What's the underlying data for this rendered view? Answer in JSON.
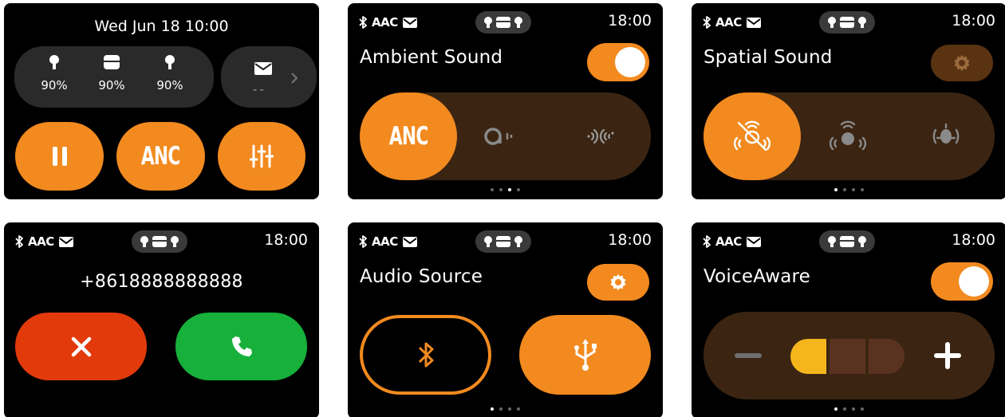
{
  "colors": {
    "accent": "#f28a1f",
    "track": "#3b2512",
    "decline": "#e23a0b",
    "accept": "#16b03a",
    "level_on": "#f5b61d",
    "level_off": "#5a3320"
  },
  "status": {
    "codec": "AAC",
    "time": "18:00",
    "icons": [
      "bluetooth-icon",
      "mail-icon",
      "earbuds-case-icon"
    ]
  },
  "home": {
    "datetime": "Wed Jun 18  10:00",
    "battery": [
      {
        "device": "left-earbud-icon",
        "percent": "90%"
      },
      {
        "device": "case-icon",
        "percent": "90%"
      },
      {
        "device": "right-earbud-icon",
        "percent": "90%"
      }
    ],
    "message_preview": "--",
    "buttons": {
      "pause": "pause-icon",
      "anc": "ANC",
      "eq": "equalizer-icon"
    }
  },
  "ambient": {
    "title": "Ambient Sound",
    "toggle_on": true,
    "options": [
      {
        "id": "anc",
        "label": "ANC",
        "active": true
      },
      {
        "id": "ambient-aware",
        "icon": "ambient-aware-icon",
        "active": false
      },
      {
        "id": "talk-thru",
        "icon": "talk-thru-icon",
        "active": false
      }
    ],
    "page_index": 2,
    "page_count": 4
  },
  "spatial": {
    "title": "Spatial Sound",
    "options": [
      {
        "id": "off",
        "icon": "spatial-off-icon",
        "active": true
      },
      {
        "id": "fixed",
        "icon": "spatial-fixed-icon",
        "active": false
      },
      {
        "id": "head-tracking",
        "icon": "head-tracking-icon",
        "active": false
      }
    ],
    "page_index": 0,
    "page_count": 4
  },
  "call": {
    "number": "+8618888888888",
    "decline": "decline-icon",
    "accept": "accept-call-icon"
  },
  "audio_source": {
    "title": "Audio Source",
    "options": [
      {
        "id": "bluetooth",
        "icon": "bluetooth-icon",
        "active": false
      },
      {
        "id": "usb",
        "icon": "usb-icon",
        "active": true
      }
    ],
    "page_index": 0,
    "page_count": 4
  },
  "voiceaware": {
    "title": "VoiceAware",
    "toggle_on": true,
    "level": 1,
    "level_max": 3,
    "page_index": 0,
    "page_count": 4
  }
}
